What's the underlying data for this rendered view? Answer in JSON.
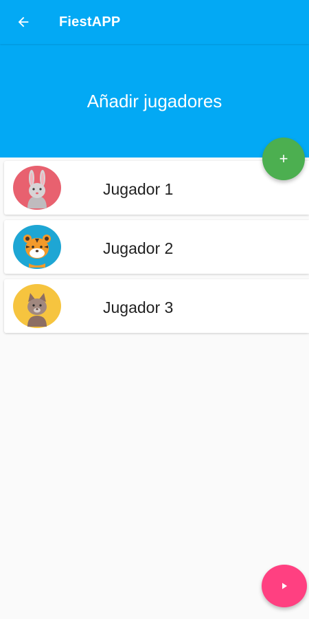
{
  "appbar": {
    "title": "FiestAPP",
    "back_icon": "arrow-back-icon"
  },
  "header": {
    "title": "Añadir jugadores"
  },
  "add_button": {
    "label": "+",
    "icon": "plus-icon"
  },
  "players": [
    {
      "name": "Jugador 1",
      "avatar": "rabbit-icon",
      "avatar_color": "#e8616f"
    },
    {
      "name": "Jugador 2",
      "avatar": "tiger-icon",
      "avatar_color": "#1ea6d4"
    },
    {
      "name": "Jugador 3",
      "avatar": "cat-icon",
      "avatar_color": "#f6c43f"
    }
  ],
  "play_button": {
    "icon": "play-icon"
  },
  "colors": {
    "primary": "#03a9f4",
    "add_fab": "#4caf50",
    "play_fab": "#ff4081",
    "background": "#fafafa"
  }
}
